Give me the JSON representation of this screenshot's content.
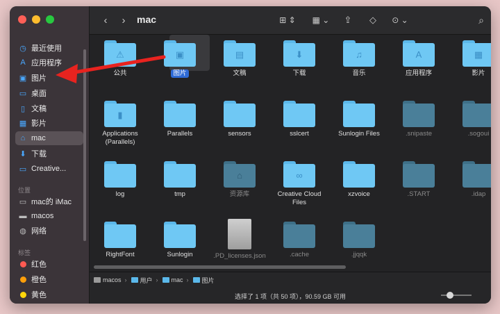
{
  "window": {
    "title": "mac"
  },
  "sidebar": {
    "favorites": [
      {
        "label": "最近使用",
        "icon": "clock-icon"
      },
      {
        "label": "应用程序",
        "icon": "apps-icon"
      },
      {
        "label": "图片",
        "icon": "pictures-icon"
      },
      {
        "label": "桌面",
        "icon": "desktop-icon"
      },
      {
        "label": "文稿",
        "icon": "document-icon"
      },
      {
        "label": "影片",
        "icon": "film-icon"
      },
      {
        "label": "mac",
        "icon": "home-icon",
        "selected": true
      },
      {
        "label": "下载",
        "icon": "download-icon"
      },
      {
        "label": "Creative...",
        "icon": "folder-icon"
      }
    ],
    "locations_header": "位置",
    "locations": [
      {
        "label": "mac的 iMac",
        "icon": "monitor-icon"
      },
      {
        "label": "macos",
        "icon": "disk-icon"
      },
      {
        "label": "网络",
        "icon": "network-icon"
      }
    ],
    "tags_header": "标签",
    "tags": [
      {
        "label": "红色",
        "color": "#ff5a52"
      },
      {
        "label": "橙色",
        "color": "#ff9f0a"
      },
      {
        "label": "黄色",
        "color": "#ffd60a"
      }
    ]
  },
  "items": [
    {
      "label": "公共",
      "glyph": "⚠",
      "dim": false
    },
    {
      "label": "图片",
      "glyph": "▣",
      "dim": false,
      "selected": true
    },
    {
      "label": "文稿",
      "glyph": "▤",
      "dim": false
    },
    {
      "label": "下载",
      "glyph": "⬇",
      "dim": false
    },
    {
      "label": "音乐",
      "glyph": "♫",
      "dim": false
    },
    {
      "label": "应用程序",
      "glyph": "A",
      "dim": false
    },
    {
      "label": "影片",
      "glyph": "▦",
      "dim": false
    },
    {
      "label": "Applications (Parallels)",
      "glyph": "▮",
      "dim": false
    },
    {
      "label": "Parallels",
      "glyph": "",
      "dim": false
    },
    {
      "label": "sensors",
      "glyph": "",
      "dim": false
    },
    {
      "label": "sslcert",
      "glyph": "",
      "dim": false
    },
    {
      "label": "Sunlogin Files",
      "glyph": "",
      "dim": false
    },
    {
      "label": ".snipaste",
      "glyph": "",
      "dim": true
    },
    {
      "label": ".sogoui",
      "glyph": "",
      "dim": true
    },
    {
      "label": "log",
      "glyph": "",
      "dim": false
    },
    {
      "label": "tmp",
      "glyph": "",
      "dim": false
    },
    {
      "label": "资源库",
      "glyph": "⌂",
      "dim": true
    },
    {
      "label": "Creative Cloud Files",
      "glyph": "∞",
      "dim": false
    },
    {
      "label": "xzvoice",
      "glyph": "",
      "dim": false
    },
    {
      "label": ".START",
      "glyph": "",
      "dim": true
    },
    {
      "label": ".idap",
      "glyph": "",
      "dim": true
    },
    {
      "label": "RightFont",
      "glyph": "",
      "dim": false
    },
    {
      "label": "Sunlogin",
      "glyph": "",
      "dim": false
    },
    {
      "label": ".PD_licenses.json",
      "glyph": "",
      "dim": true,
      "doc": true
    },
    {
      "label": ".cache",
      "glyph": "",
      "dim": true
    },
    {
      "label": ".jjqqk",
      "glyph": "",
      "dim": true
    }
  ],
  "pathbar": [
    "macos",
    "用户",
    "mac",
    "图片"
  ],
  "status": {
    "text": "选择了 1 项（共 50 项），90.59 GB 可用"
  },
  "colors": {
    "accent": "#2f6bd6",
    "folder": "#6fc8f4",
    "arrow": "#e8231f"
  }
}
